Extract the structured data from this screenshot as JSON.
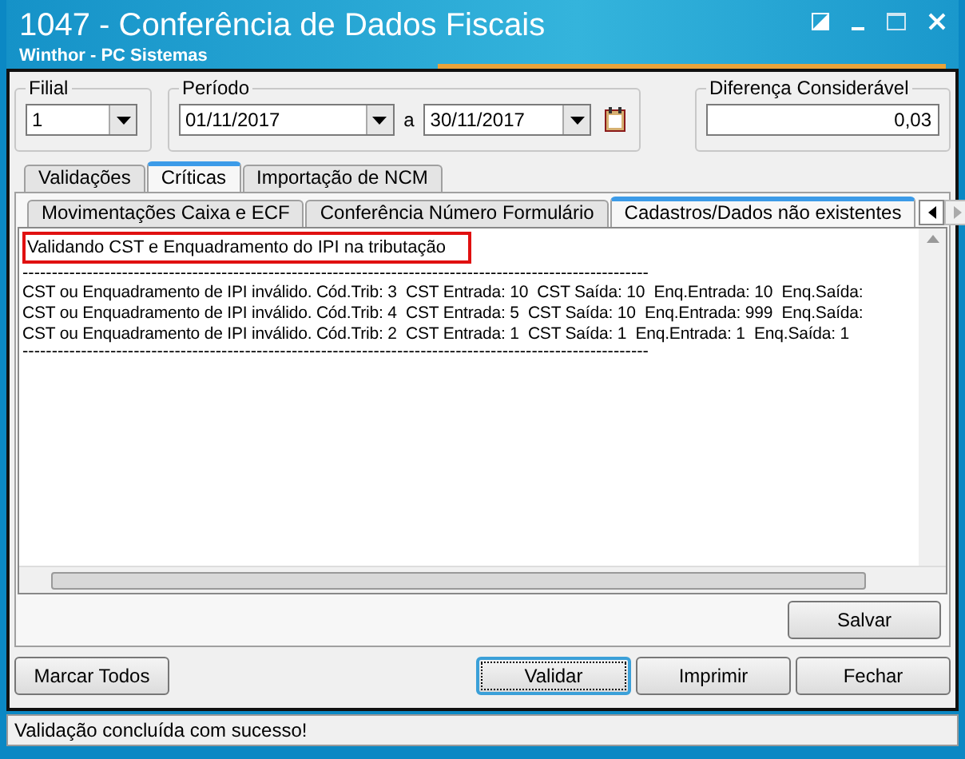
{
  "window": {
    "title": "1047 - Conferência de Dados Fiscais",
    "subtitle": "Winthor - PC Sistemas"
  },
  "filial": {
    "label": "Filial",
    "value": "1"
  },
  "periodo": {
    "label": "Período",
    "from": "01/11/2017",
    "separator": "a",
    "to": "30/11/2017"
  },
  "diferenca": {
    "label": "Diferença Considerável",
    "value": "0,03"
  },
  "tabs": [
    {
      "label": "Validações",
      "selected": false
    },
    {
      "label": "Críticas",
      "selected": true
    },
    {
      "label": "Importação de NCM",
      "selected": false
    }
  ],
  "subtabs": [
    {
      "label": "Movimentações Caixa e ECF",
      "selected": false
    },
    {
      "label": "Conferência Número Formulário",
      "selected": false
    },
    {
      "label": "Cadastros/Dados não existentes",
      "selected": true
    }
  ],
  "log_lines": [
    {
      "kind": "heading",
      "text": "Validando CST e Enquadramento do IPI na tributação"
    },
    {
      "kind": "rule",
      "text": "-----------------------------------------------------------------------------------------------------------"
    },
    {
      "kind": "row",
      "text": "CST ou Enquadramento de IPI inválido. Cód.Trib: 3  CST Entrada: 10  CST Saída: 10  Enq.Entrada: 10  Enq.Saída:"
    },
    {
      "kind": "row",
      "text": "CST ou Enquadramento de IPI inválido. Cód.Trib: 4  CST Entrada: 5  CST Saída: 10  Enq.Entrada: 999  Enq.Saída:"
    },
    {
      "kind": "row",
      "text": "CST ou Enquadramento de IPI inválido. Cód.Trib: 2  CST Entrada: 1  CST Saída: 1  Enq.Entrada: 1  Enq.Saída: 1"
    },
    {
      "kind": "rule",
      "text": "-----------------------------------------------------------------------------------------------------------"
    }
  ],
  "save_button": "Salvar",
  "buttons": [
    {
      "label": "Marcar Todos",
      "focused": false
    },
    {
      "label": "Validar",
      "focused": true
    },
    {
      "label": "Imprimir",
      "focused": false
    },
    {
      "label": "Fechar",
      "focused": false
    }
  ],
  "status_bar": "Validação concluída com sucesso!"
}
